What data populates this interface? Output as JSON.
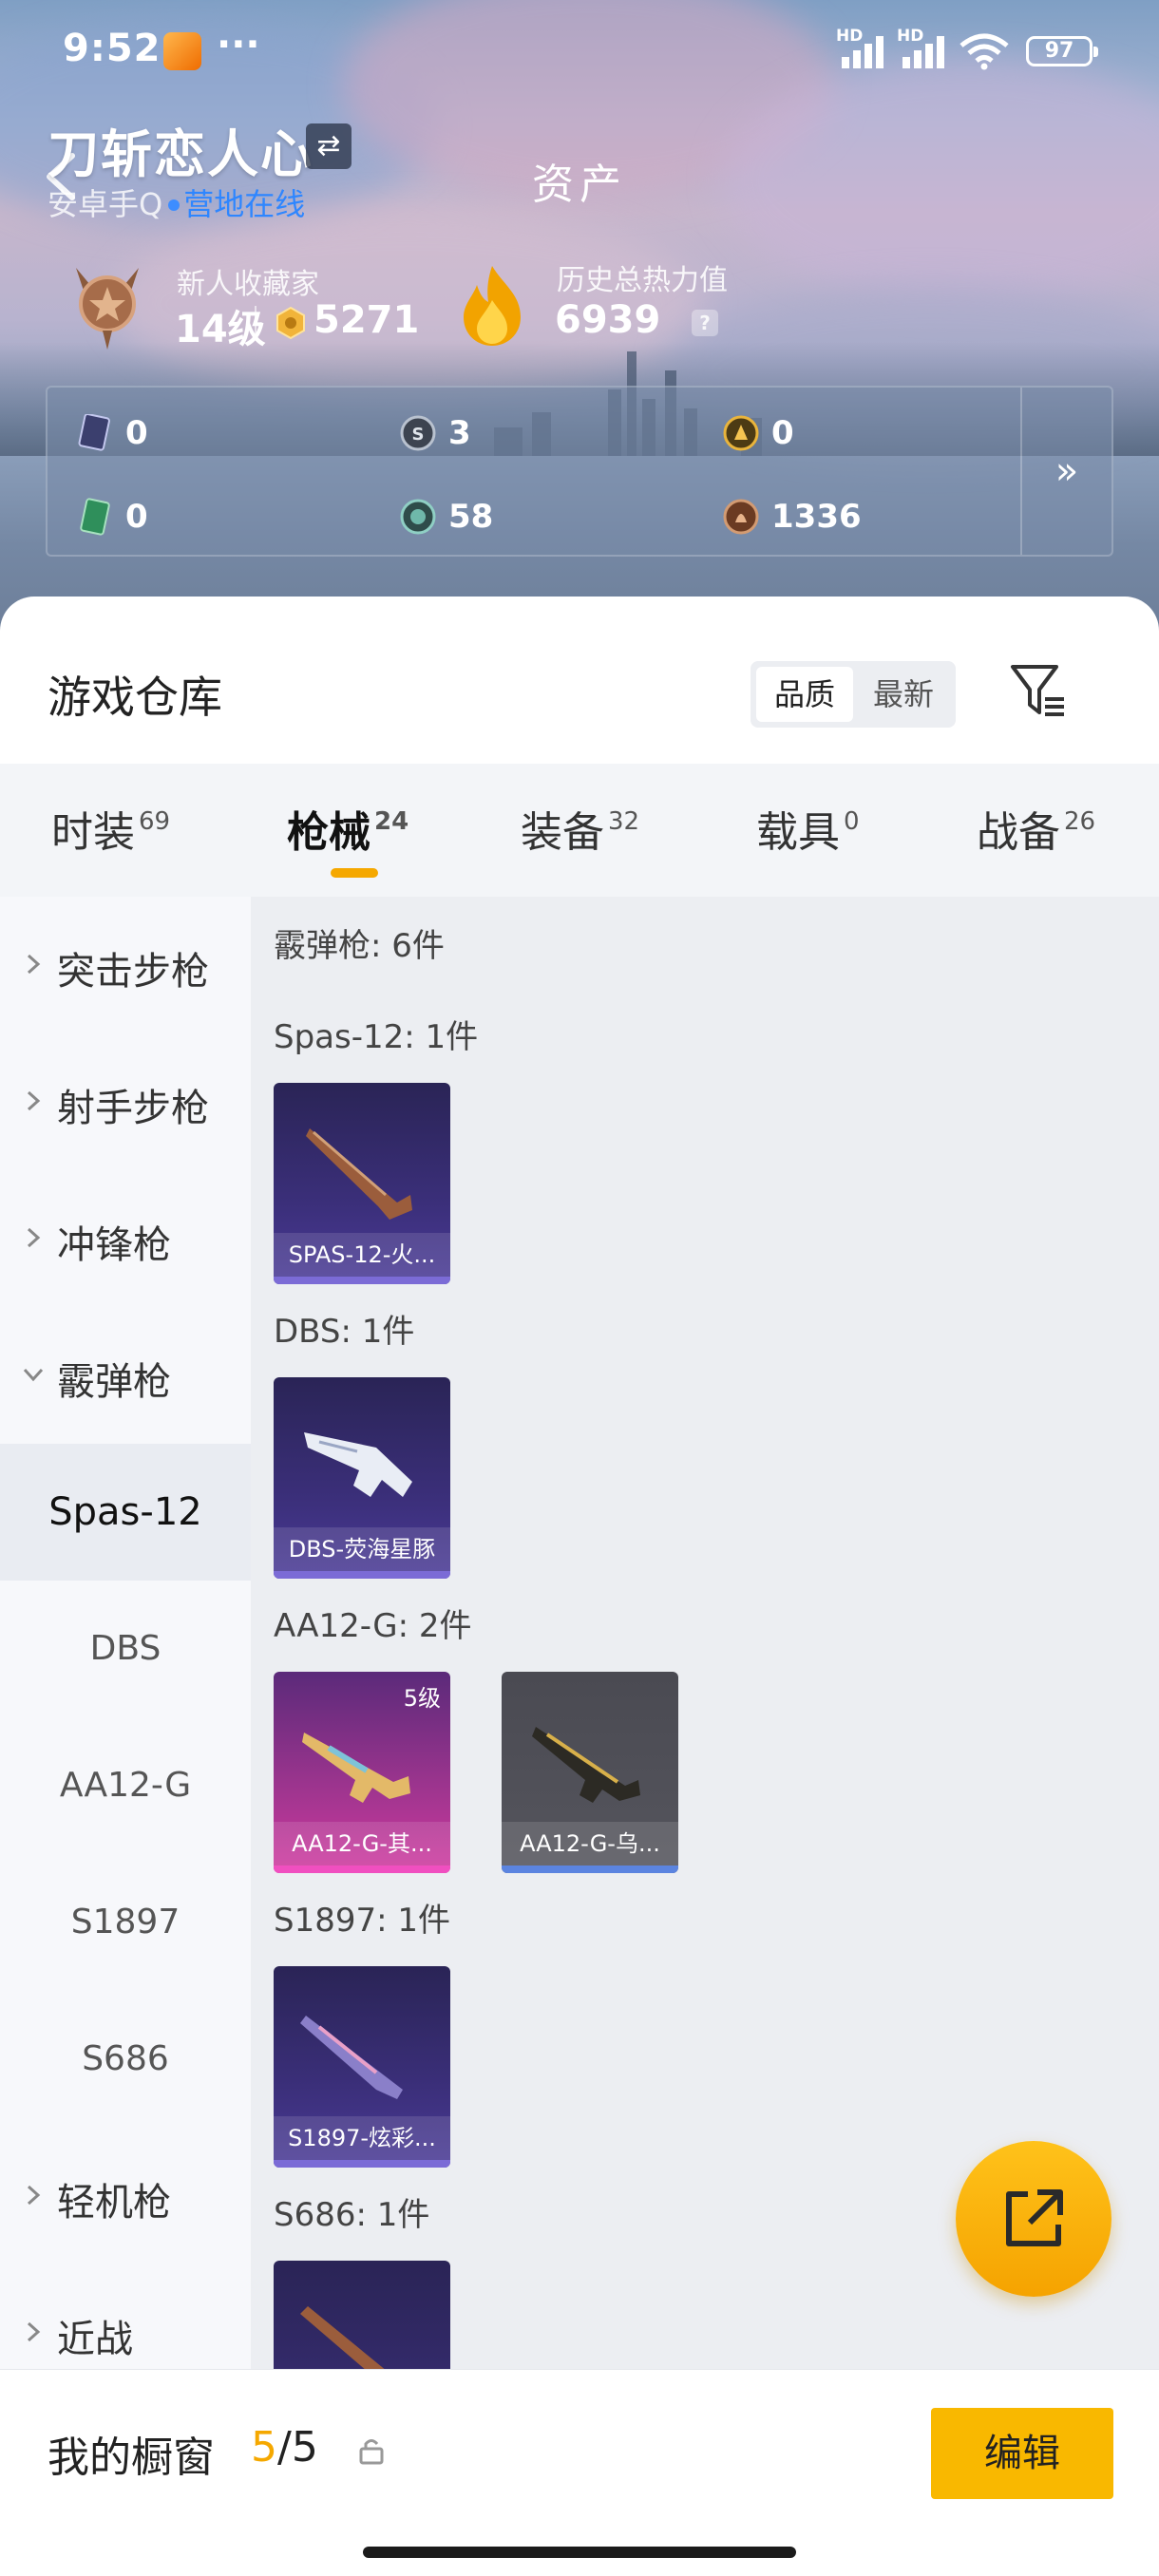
{
  "status_bar": {
    "time": "9:52",
    "battery": "97",
    "more": "···"
  },
  "header": {
    "nickname": "刀斩恋人心",
    "swap_icon": "⇄",
    "platform": "安卓手Q",
    "online_status": "营地在线",
    "page_title": "资产",
    "rank_title": "新人收藏家",
    "level": "14级",
    "coins": "5271",
    "heat_title": "历史总热力值",
    "heat_value": "6939",
    "help": "?"
  },
  "assets": [
    {
      "icon": "card-icon",
      "value": "0"
    },
    {
      "icon": "silver-coin-icon",
      "value": "3"
    },
    {
      "icon": "gold-token-icon",
      "value": "0"
    },
    {
      "icon": "green-ticket-icon",
      "value": "0"
    },
    {
      "icon": "teal-gem-icon",
      "value": "58"
    },
    {
      "icon": "bronze-coin-icon",
      "value": "1336"
    }
  ],
  "warehouse": {
    "title": "游戏仓库",
    "sort": [
      "品质",
      "最新"
    ],
    "tabs": [
      {
        "label": "时装",
        "count": "69"
      },
      {
        "label": "枪械",
        "count": "24"
      },
      {
        "label": "装备",
        "count": "32"
      },
      {
        "label": "载具",
        "count": "0"
      },
      {
        "label": "战备",
        "count": "26"
      }
    ],
    "categories": [
      "突击步枪",
      "射手步枪",
      "冲锋枪",
      "霰弹枪",
      "轻机枪",
      "近战"
    ],
    "subcategories": [
      "Spas-12",
      "DBS",
      "AA12-G",
      "S1897",
      "S686"
    ],
    "summary": "霰弹枪: 6件",
    "groups": [
      {
        "title": "Spas-12: 1件",
        "items": [
          {
            "name": "SPAS-12-火...",
            "level": ""
          }
        ]
      },
      {
        "title": "DBS: 1件",
        "items": [
          {
            "name": "DBS-荧海星豚",
            "level": ""
          }
        ]
      },
      {
        "title": "AA12-G: 2件",
        "items": [
          {
            "name": "AA12-G-其...",
            "level": "5级"
          },
          {
            "name": "AA12-G-乌...",
            "level": ""
          }
        ]
      },
      {
        "title": "S1897: 1件",
        "items": [
          {
            "name": "S1897-炫彩...",
            "level": ""
          }
        ]
      },
      {
        "title": "S686: 1件",
        "items": []
      }
    ]
  },
  "showcase": {
    "label": "我的橱窗",
    "current": "5",
    "total": "/5",
    "edit": "编辑"
  },
  "colors": {
    "accent": "#f5a800",
    "purple_card": "#3f2f7c",
    "pink_card": "#d0399f",
    "gray_card": "#55555d"
  }
}
